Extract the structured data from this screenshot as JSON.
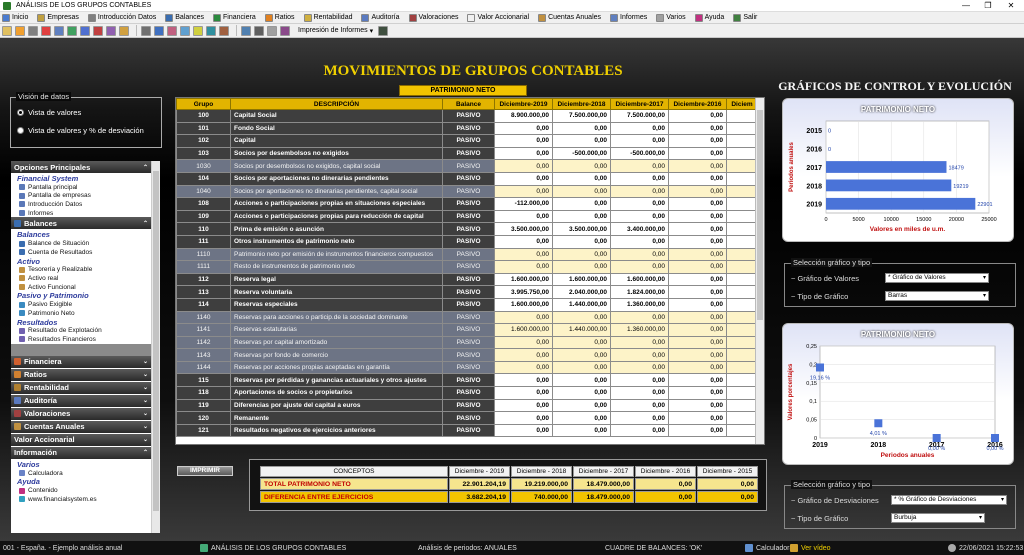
{
  "window": {
    "title": "ANÁLISIS DE LOS GRUPOS CONTABLES",
    "minimize": "—",
    "maximize": "❐",
    "close": "✕"
  },
  "menu": [
    {
      "label": "Inicio",
      "color": "#4a7bd0"
    },
    {
      "label": "Empresas",
      "color": "#c0a040"
    },
    {
      "label": "Introducción Datos",
      "color": "#808080"
    },
    {
      "label": "Balances",
      "color": "#3a6db0"
    },
    {
      "label": "Financiera",
      "color": "#2b8a3e"
    },
    {
      "label": "Ratios",
      "color": "#e08020"
    },
    {
      "label": "Rentabilidad",
      "color": "#d0b040"
    },
    {
      "label": "Auditoría",
      "color": "#5a7ac0"
    },
    {
      "label": "Valoraciones",
      "color": "#a04040"
    },
    {
      "label": "Valor Accionarial",
      "color": "#f0f0f0"
    },
    {
      "label": "Cuentas Anuales",
      "color": "#c09040"
    },
    {
      "label": "Informes",
      "color": "#6080c0"
    },
    {
      "label": "Varios",
      "color": "#a0a0a0"
    },
    {
      "label": "Ayuda",
      "color": "#c03080"
    },
    {
      "label": "Salir",
      "color": "#408040"
    }
  ],
  "toolbar": {
    "print_menu": "Impresión de Informes"
  },
  "main_title": "MOVIMIENTOS DE GRUPOS CONTABLES",
  "graphs_title": "GRÁFICOS DE CONTROL Y EVOLUCIÓN",
  "table_label": "PATRIMONIO NETO",
  "vision": {
    "caption": "Visión de datos",
    "opt1": "Vista de valores",
    "opt2": "Vista de valores y % de desviación"
  },
  "nav": {
    "principales": "Opciones Principales",
    "financial_system": "Financial System",
    "fs_items": [
      "Pantalla principal",
      "Pantalla de empresas",
      "Introducción Datos",
      "Informes"
    ],
    "balances": "Balances",
    "bal_sub": "Balances",
    "bal_items": [
      "Balance de Situación",
      "Cuenta de Resultados"
    ],
    "activo": "Activo",
    "act_items": [
      "Tesorería y Realizable",
      "Activo real",
      "Activo Funcional"
    ],
    "pyp": "Pasivo y Patrimonio",
    "pyp_items": [
      "Pasivo Exigible",
      "Patrimonio Neto"
    ],
    "resultados": "Resultados",
    "res_items": [
      "Resultado de Explotación",
      "Resultados Financieros"
    ],
    "headers": [
      {
        "label": "Financiera",
        "color": "#d06030"
      },
      {
        "label": "Ratios",
        "color": "#d08030"
      },
      {
        "label": "Rentabilidad",
        "color": "#b08030"
      },
      {
        "label": "Auditoría",
        "color": "#5a7ac0"
      },
      {
        "label": "Valoraciones",
        "color": "#a04040"
      },
      {
        "label": "Cuentas Anuales",
        "color": "#c09040"
      }
    ],
    "valor": "Valor Accionarial",
    "informacion": "Información",
    "varios": "Varios",
    "calc": "Calculadora",
    "ayuda": "Ayuda",
    "contenido": "Contenido",
    "web": "www.financialsystem.es"
  },
  "grid": {
    "headers": [
      "Grupo",
      "DESCRIPCIÓN",
      "Balance",
      "Diciembre-2019",
      "Diciembre-2018",
      "Diciembre-2017",
      "Diciembre-2016",
      "Diciem"
    ],
    "rows": [
      {
        "t": "main",
        "c": [
          "100",
          "Capital Social",
          "PASIVO",
          "8.900.000,00",
          "7.500.000,00",
          "7.500.000,00",
          "0,00",
          ""
        ]
      },
      {
        "t": "main",
        "c": [
          "101",
          "Fondo Social",
          "PASIVO",
          "0,00",
          "0,00",
          "0,00",
          "0,00",
          ""
        ]
      },
      {
        "t": "main",
        "c": [
          "102",
          "Capital",
          "PASIVO",
          "0,00",
          "0,00",
          "0,00",
          "0,00",
          ""
        ]
      },
      {
        "t": "main",
        "c": [
          "103",
          "Socios por desembolsos no exigidos",
          "PASIVO",
          "0,00",
          "-500.000,00",
          "-500.000,00",
          "0,00",
          ""
        ]
      },
      {
        "t": "sub",
        "c": [
          "1030",
          "Socios por desembolsos no exigidos, capital social",
          "PASIVO",
          "0,00",
          "0,00",
          "0,00",
          "0,00",
          ""
        ]
      },
      {
        "t": "main",
        "c": [
          "104",
          "Socios por aportaciones no dinerarias pendientes",
          "PASIVO",
          "0,00",
          "0,00",
          "0,00",
          "0,00",
          ""
        ]
      },
      {
        "t": "sub",
        "c": [
          "1040",
          "Socios por aportaciones no dinerarias pendientes, capital social",
          "PASIVO",
          "0,00",
          "0,00",
          "0,00",
          "0,00",
          ""
        ]
      },
      {
        "t": "main",
        "c": [
          "108",
          "Acciones o participaciones propias en situaciones especiales",
          "PASIVO",
          "-112.000,00",
          "0,00",
          "0,00",
          "0,00",
          ""
        ]
      },
      {
        "t": "main",
        "c": [
          "109",
          "Acciones o participaciones propias para reducción de capital",
          "PASIVO",
          "0,00",
          "0,00",
          "0,00",
          "0,00",
          ""
        ]
      },
      {
        "t": "main",
        "c": [
          "110",
          "Prima de emisión o asunción",
          "PASIVO",
          "3.500.000,00",
          "3.500.000,00",
          "3.400.000,00",
          "0,00",
          ""
        ]
      },
      {
        "t": "main",
        "c": [
          "111",
          "Otros instrumentos de patrimonio neto",
          "PASIVO",
          "0,00",
          "0,00",
          "0,00",
          "0,00",
          ""
        ]
      },
      {
        "t": "sub",
        "c": [
          "1110",
          "Patrimonio neto por emisión de instrumentos financieros compuestos",
          "PASIVO",
          "0,00",
          "0,00",
          "0,00",
          "0,00",
          ""
        ]
      },
      {
        "t": "sub",
        "c": [
          "1111",
          "Resto de instrumentos de patrimonio neto",
          "PASIVO",
          "0,00",
          "0,00",
          "0,00",
          "0,00",
          ""
        ]
      },
      {
        "t": "main",
        "c": [
          "112",
          "Reserva legal",
          "PASIVO",
          "1.600.000,00",
          "1.600.000,00",
          "1.600.000,00",
          "0,00",
          ""
        ]
      },
      {
        "t": "main",
        "c": [
          "113",
          "Reserva voluntaria",
          "PASIVO",
          "3.995.750,00",
          "2.040.000,00",
          "1.824.000,00",
          "0,00",
          ""
        ]
      },
      {
        "t": "main",
        "c": [
          "114",
          "Reservas especiales",
          "PASIVO",
          "1.600.000,00",
          "1.440.000,00",
          "1.360.000,00",
          "0,00",
          ""
        ]
      },
      {
        "t": "sub",
        "c": [
          "1140",
          "Reservas para acciones o particip.de la sociedad dominante",
          "PASIVO",
          "0,00",
          "0,00",
          "0,00",
          "0,00",
          ""
        ]
      },
      {
        "t": "sub",
        "c": [
          "1141",
          "Reservas estatutarias",
          "PASIVO",
          "1.600.000,00",
          "1.440.000,00",
          "1.360.000,00",
          "0,00",
          ""
        ]
      },
      {
        "t": "sub",
        "c": [
          "1142",
          "Reservas por capital amortizado",
          "PASIVO",
          "0,00",
          "0,00",
          "0,00",
          "0,00",
          ""
        ]
      },
      {
        "t": "sub",
        "c": [
          "1143",
          "Reservas por fondo de comercio",
          "PASIVO",
          "0,00",
          "0,00",
          "0,00",
          "0,00",
          ""
        ]
      },
      {
        "t": "sub",
        "c": [
          "1144",
          "Reservas por acciones propias aceptadas en garantía",
          "PASIVO",
          "0,00",
          "0,00",
          "0,00",
          "0,00",
          ""
        ]
      },
      {
        "t": "main",
        "c": [
          "115",
          "Reservas por pérdidas y ganancias actuariales y otros ajustes",
          "PASIVO",
          "0,00",
          "0,00",
          "0,00",
          "0,00",
          ""
        ]
      },
      {
        "t": "main",
        "c": [
          "118",
          "Aportaciones de socios o propietarios",
          "PASIVO",
          "0,00",
          "0,00",
          "0,00",
          "0,00",
          ""
        ]
      },
      {
        "t": "main",
        "c": [
          "119",
          "Diferencias por ajuste del capital a euros",
          "PASIVO",
          "0,00",
          "0,00",
          "0,00",
          "0,00",
          ""
        ]
      },
      {
        "t": "main",
        "c": [
          "120",
          "Remanente",
          "PASIVO",
          "0,00",
          "0,00",
          "0,00",
          "0,00",
          ""
        ]
      },
      {
        "t": "main",
        "c": [
          "121",
          "Resultados negativos de ejercicios anteriores",
          "PASIVO",
          "0,00",
          "0,00",
          "0,00",
          "0,00",
          ""
        ]
      }
    ]
  },
  "print_button": "IMPRIMIR",
  "summary": {
    "headers": [
      "CONCEPTOS",
      "Diciembre - 2019",
      "Diciembre - 2018",
      "Diciembre - 2017",
      "Diciembre - 2016",
      "Diciembre - 2015"
    ],
    "total": [
      "TOTAL PATRIMONIO NETO",
      "22.901.204,19",
      "19.219.000,00",
      "18.479.000,00",
      "0,00",
      "0,00"
    ],
    "diff": [
      "DIFERENCIA ENTRE EJERCICIOS",
      "3.682.204,19",
      "740.000,00",
      "18.479.000,00",
      "0,00",
      "0,00"
    ]
  },
  "chart_data": [
    {
      "type": "bar",
      "orientation": "horizontal",
      "title": "PATRIMONIO NETO",
      "xlabel": "Valores en miles de u.m.",
      "ylabel": "Periodos anuales",
      "categories": [
        "2015",
        "2016",
        "2017",
        "2018",
        "2019"
      ],
      "values": [
        0,
        0,
        18479,
        19219,
        22901
      ],
      "value_labels": [
        "0",
        "0",
        "18479",
        "19219",
        "22901"
      ],
      "xticks": [
        "0",
        "5000",
        "10000",
        "15000",
        "20000",
        "25000"
      ],
      "xlim": [
        0,
        25000
      ],
      "bar_color": "#4a73d8"
    },
    {
      "type": "scatter",
      "title": "PATRIMONIO NETO",
      "xlabel": "Periodos anuales",
      "ylabel": "Valores porcentajes",
      "x": [
        "2019",
        "2018",
        "2017",
        "2016"
      ],
      "values": [
        0.1916,
        0.0401,
        0,
        0
      ],
      "value_labels": [
        "19,16 %",
        "4,01 %",
        "0,00 %",
        "0,00 %"
      ],
      "yticks": [
        "0",
        "0,05",
        "0,1",
        "0,15",
        "0,2",
        "0,25"
      ],
      "ylim": [
        0,
        0.25
      ],
      "marker_color": "#4a73d8"
    }
  ],
  "sel1": {
    "caption": "Selección gráfico y tipo",
    "l1": "~ Gráfico de Valores",
    "v1": "* Gráfico de Valores",
    "l2": "~ Tipo de Gráfico",
    "v2": "Barras"
  },
  "sel2": {
    "caption": "Selección gráfico y tipo",
    "l1": "~ Gráfico de Desviaciones",
    "v1": "* % Gráfico de Desviaciones",
    "l2": "~ Tipo de Gráfico",
    "v2": "Burbuja"
  },
  "status": {
    "s1": "001 - España. - Ejemplo análisis anual",
    "s2": "ANÁLISIS DE LOS GRUPOS CONTABLES",
    "s3": "Análisis de periodos: ANUALES",
    "s4": "CUADRE DE BALANCES: 'OK'",
    "s5": "Calculadora",
    "s6": "Ver vídeo",
    "s7": "22/06/2021 15:22:53"
  }
}
